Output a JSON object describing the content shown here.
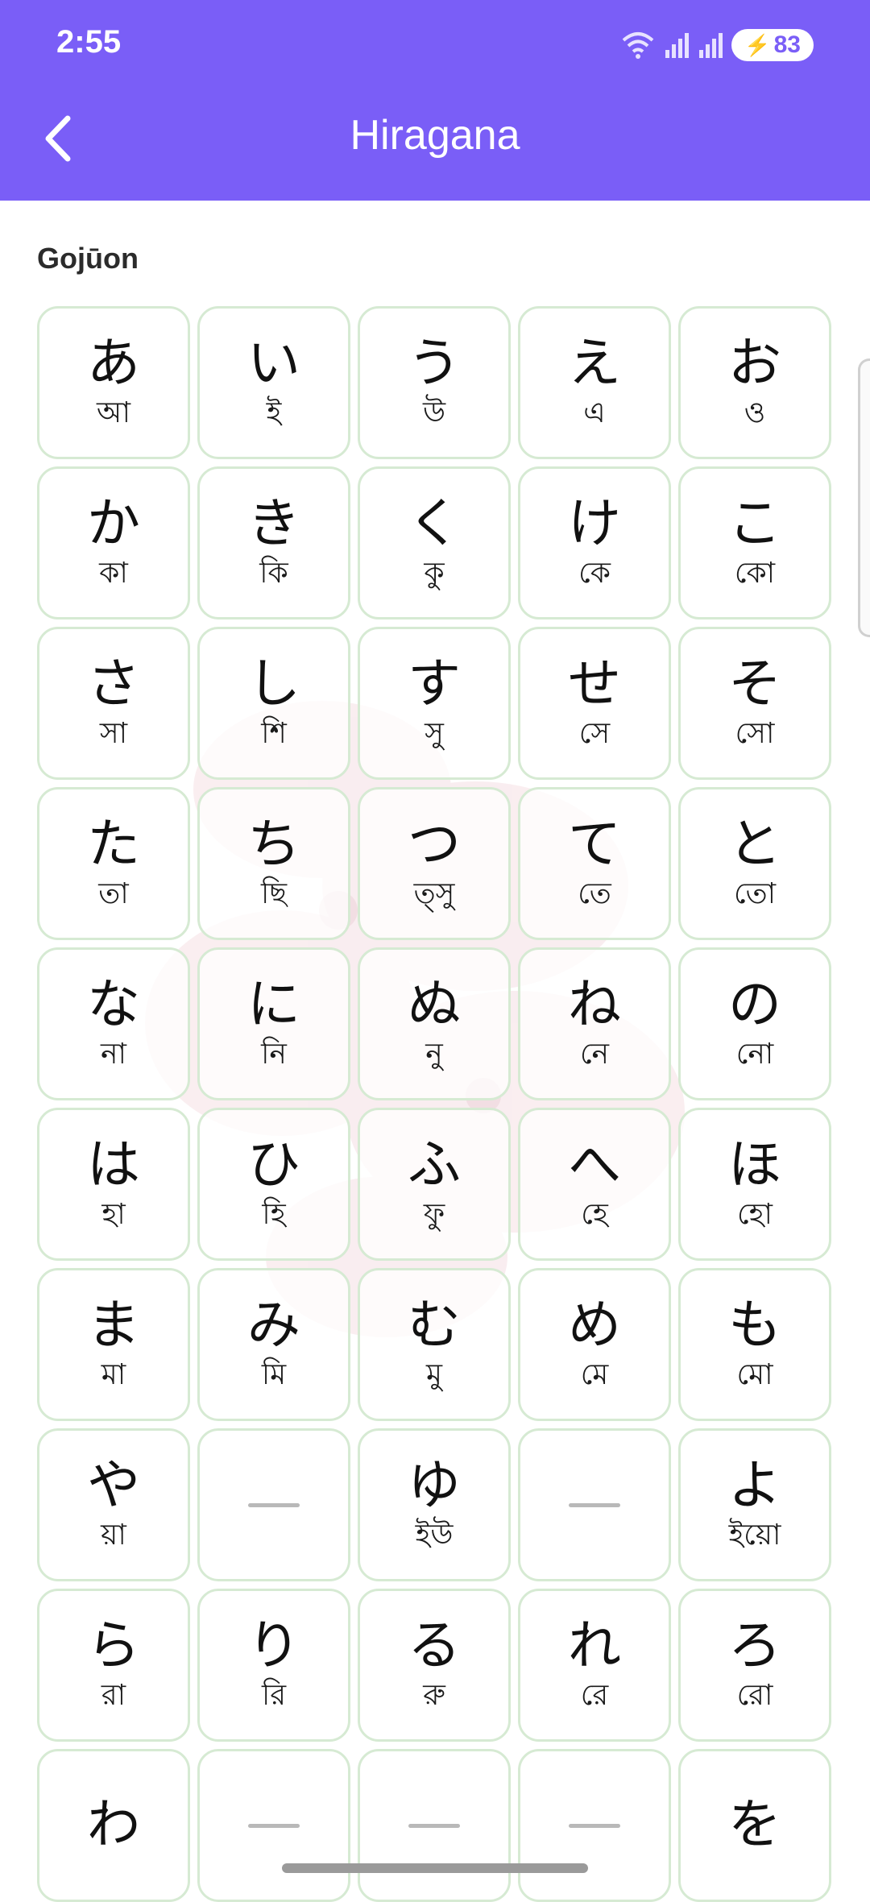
{
  "status_bar": {
    "time": "2:55",
    "battery": "83"
  },
  "header": {
    "title": "Hiragana",
    "back_icon": "chevron-left-icon"
  },
  "section": {
    "label": "Gojūon"
  },
  "colors": {
    "accent": "#7a5ef7",
    "cell_border": "#d6ead3"
  },
  "grid": [
    {
      "kana": "あ",
      "reading": "আ"
    },
    {
      "kana": "い",
      "reading": "ই"
    },
    {
      "kana": "う",
      "reading": "উ"
    },
    {
      "kana": "え",
      "reading": "এ"
    },
    {
      "kana": "お",
      "reading": "ও"
    },
    {
      "kana": "か",
      "reading": "কা"
    },
    {
      "kana": "き",
      "reading": "কি"
    },
    {
      "kana": "く",
      "reading": "কু"
    },
    {
      "kana": "け",
      "reading": "কে"
    },
    {
      "kana": "こ",
      "reading": "কো"
    },
    {
      "kana": "さ",
      "reading": "সা"
    },
    {
      "kana": "し",
      "reading": "শি"
    },
    {
      "kana": "す",
      "reading": "সু"
    },
    {
      "kana": "せ",
      "reading": "সে"
    },
    {
      "kana": "そ",
      "reading": "সো"
    },
    {
      "kana": "た",
      "reading": "তা"
    },
    {
      "kana": "ち",
      "reading": "ছি"
    },
    {
      "kana": "つ",
      "reading": "ত্সু"
    },
    {
      "kana": "て",
      "reading": "তে"
    },
    {
      "kana": "と",
      "reading": "তো"
    },
    {
      "kana": "な",
      "reading": "না"
    },
    {
      "kana": "に",
      "reading": "নি"
    },
    {
      "kana": "ぬ",
      "reading": "নু"
    },
    {
      "kana": "ね",
      "reading": "নে"
    },
    {
      "kana": "の",
      "reading": "নো"
    },
    {
      "kana": "は",
      "reading": "হা"
    },
    {
      "kana": "ひ",
      "reading": "হি"
    },
    {
      "kana": "ふ",
      "reading": "ফু"
    },
    {
      "kana": "へ",
      "reading": "হে"
    },
    {
      "kana": "ほ",
      "reading": "হো"
    },
    {
      "kana": "ま",
      "reading": "মা"
    },
    {
      "kana": "み",
      "reading": "মি"
    },
    {
      "kana": "む",
      "reading": "মু"
    },
    {
      "kana": "め",
      "reading": "মে"
    },
    {
      "kana": "も",
      "reading": "মো"
    },
    {
      "kana": "や",
      "reading": "য়া"
    },
    {
      "empty": true
    },
    {
      "kana": "ゆ",
      "reading": "ইউ"
    },
    {
      "empty": true
    },
    {
      "kana": "よ",
      "reading": "ইয়ো"
    },
    {
      "kana": "ら",
      "reading": "রা"
    },
    {
      "kana": "り",
      "reading": "রি"
    },
    {
      "kana": "る",
      "reading": "রু"
    },
    {
      "kana": "れ",
      "reading": "রে"
    },
    {
      "kana": "ろ",
      "reading": "রো"
    },
    {
      "kana": "わ",
      "reading": ""
    },
    {
      "empty": true
    },
    {
      "empty": true
    },
    {
      "empty": true
    },
    {
      "kana": "を",
      "reading": ""
    }
  ]
}
